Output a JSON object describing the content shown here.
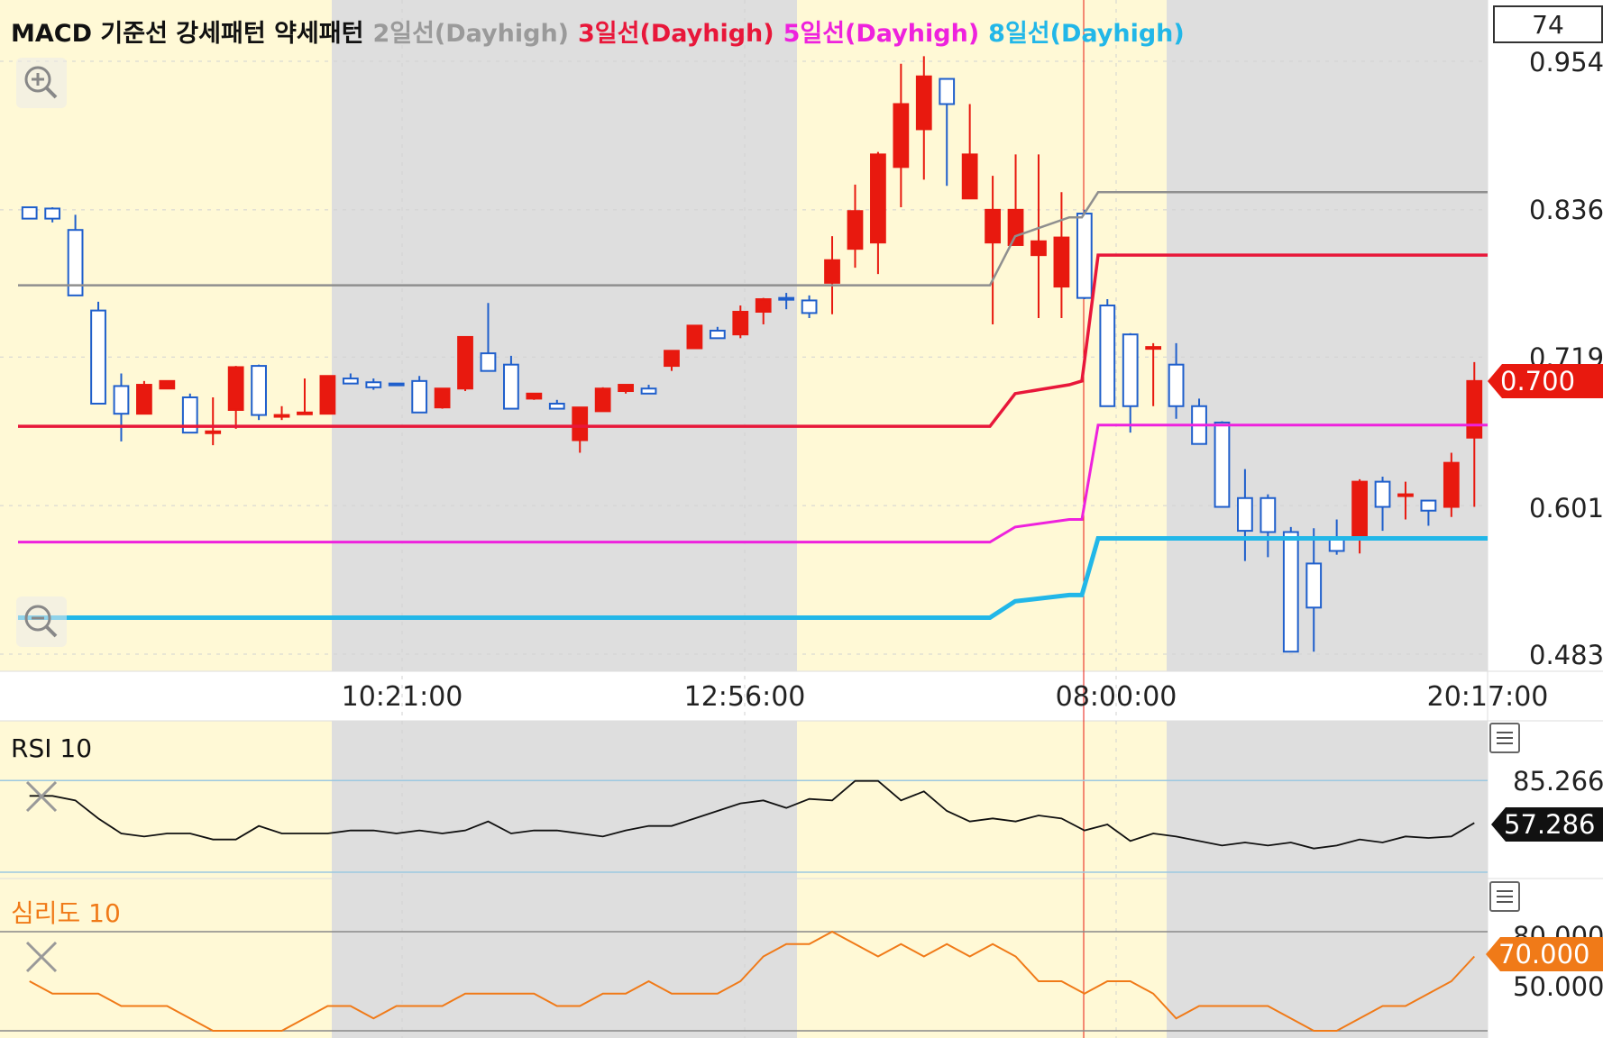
{
  "legend": [
    {
      "text": "MACD 기준선 강세패턴 약세패턴",
      "color": "#111111"
    },
    {
      "text": "2일선(Dayhigh)",
      "color": "#9a9a9a"
    },
    {
      "text": "3일선(Dayhigh)",
      "color": "#e8173a"
    },
    {
      "text": "5일선(Dayhigh)",
      "color": "#ee22dd"
    },
    {
      "text": "8일선(Dayhigh)",
      "color": "#22b7e8"
    }
  ],
  "top_box_value": "74",
  "price_axis": [
    "0.954",
    "0.836",
    "0.719",
    "0.601",
    "0.483"
  ],
  "current_price": "0.700",
  "time_axis": [
    "10:21:00",
    "12:56:00",
    "08:00:00",
    "20:17:00"
  ],
  "rsi": {
    "title": "RSI 10",
    "levels": [
      "85.266",
      "57.286"
    ],
    "current": "57.286"
  },
  "psych": {
    "title": "심리도 10",
    "levels": [
      "80.000",
      "50.000"
    ],
    "current": "70.000"
  },
  "colors": {
    "up": "#e8190f",
    "down": "#1f5fcc",
    "bg_yellow": "#fff9d6",
    "bg_gray": "#dedede",
    "ma2": "#8f8f8f",
    "ma3": "#e8173a",
    "ma5": "#ee22dd",
    "ma8": "#22b7e8",
    "rsi_line": "#111111",
    "psych_line": "#f07a18"
  },
  "chart_data": {
    "type": "candlestick",
    "x": [
      "10:21:00",
      "12:56:00",
      "08:00:00",
      "20:17:00"
    ],
    "ylim": [
      0.483,
      0.954
    ],
    "series": [
      {
        "name": "2일선(Dayhigh)",
        "values": [
          0.776,
          0.776,
          0.776,
          0.776,
          0.815,
          0.83,
          0.83,
          0.85,
          0.85,
          0.85
        ]
      },
      {
        "name": "3일선(Dayhigh)",
        "values": [
          0.664,
          0.664,
          0.664,
          0.664,
          0.69,
          0.697,
          0.7,
          0.8,
          0.8,
          0.8
        ]
      },
      {
        "name": "5일선(Dayhigh)",
        "values": [
          0.572,
          0.572,
          0.572,
          0.572,
          0.584,
          0.59,
          0.59,
          0.665,
          0.665,
          0.665
        ]
      },
      {
        "name": "8일선(Dayhigh)",
        "values": [
          0.512,
          0.512,
          0.512,
          0.512,
          0.525,
          0.53,
          0.53,
          0.575,
          0.575,
          0.575
        ]
      }
    ],
    "candles": [
      [
        0.838,
        0.838,
        0.829,
        0.829
      ],
      [
        0.837,
        0.838,
        0.826,
        0.829
      ],
      [
        0.82,
        0.832,
        0.768,
        0.768
      ],
      [
        0.756,
        0.763,
        0.682,
        0.682
      ],
      [
        0.696,
        0.706,
        0.652,
        0.674
      ],
      [
        0.674,
        0.7,
        0.674,
        0.697
      ],
      [
        0.694,
        0.7,
        0.694,
        0.7
      ],
      [
        0.687,
        0.69,
        0.662,
        0.659
      ],
      [
        0.66,
        0.687,
        0.649,
        0.66
      ],
      [
        0.677,
        0.712,
        0.662,
        0.711
      ],
      [
        0.712,
        0.713,
        0.669,
        0.673
      ],
      [
        0.672,
        0.68,
        0.669,
        0.673
      ],
      [
        0.675,
        0.702,
        0.675,
        0.675
      ],
      [
        0.674,
        0.704,
        0.674,
        0.704
      ],
      [
        0.702,
        0.706,
        0.7,
        0.698
      ],
      [
        0.699,
        0.702,
        0.693,
        0.695
      ],
      [
        0.698,
        0.698,
        0.696,
        0.697
      ],
      [
        0.7,
        0.704,
        0.676,
        0.675
      ],
      [
        0.679,
        0.694,
        0.678,
        0.694
      ],
      [
        0.694,
        0.735,
        0.692,
        0.735
      ],
      [
        0.722,
        0.762,
        0.709,
        0.708
      ],
      [
        0.713,
        0.72,
        0.678,
        0.678
      ],
      [
        0.686,
        0.689,
        0.685,
        0.69
      ],
      [
        0.682,
        0.685,
        0.678,
        0.678
      ],
      [
        0.653,
        0.679,
        0.643,
        0.679
      ],
      [
        0.676,
        0.695,
        0.677,
        0.694
      ],
      [
        0.692,
        0.697,
        0.69,
        0.697
      ],
      [
        0.694,
        0.697,
        0.69,
        0.69
      ],
      [
        0.712,
        0.724,
        0.708,
        0.724
      ],
      [
        0.726,
        0.744,
        0.726,
        0.744
      ],
      [
        0.74,
        0.743,
        0.735,
        0.734
      ],
      [
        0.737,
        0.76,
        0.734,
        0.755
      ],
      [
        0.755,
        0.766,
        0.745,
        0.765
      ],
      [
        0.766,
        0.77,
        0.757,
        0.765
      ],
      [
        0.764,
        0.768,
        0.75,
        0.754
      ],
      [
        0.778,
        0.815,
        0.753,
        0.796
      ],
      [
        0.805,
        0.856,
        0.79,
        0.835
      ],
      [
        0.81,
        0.882,
        0.785,
        0.88
      ],
      [
        0.87,
        0.952,
        0.838,
        0.92
      ],
      [
        0.9,
        0.958,
        0.86,
        0.942
      ],
      [
        0.94,
        0.937,
        0.855,
        0.92
      ],
      [
        0.845,
        0.92,
        0.88,
        0.88
      ],
      [
        0.81,
        0.863,
        0.745,
        0.836
      ],
      [
        0.808,
        0.88,
        0.81,
        0.836
      ],
      [
        0.8,
        0.88,
        0.75,
        0.811
      ],
      [
        0.775,
        0.85,
        0.75,
        0.814
      ],
      [
        0.833,
        0.836,
        0.765,
        0.766
      ],
      [
        0.76,
        0.765,
        0.68,
        0.68
      ],
      [
        0.737,
        0.738,
        0.659,
        0.68
      ],
      [
        0.727,
        0.73,
        0.68,
        0.727
      ],
      [
        0.713,
        0.73,
        0.67,
        0.68
      ],
      [
        0.68,
        0.686,
        0.66,
        0.65
      ],
      [
        0.667,
        0.668,
        0.601,
        0.6
      ],
      [
        0.607,
        0.63,
        0.557,
        0.581
      ],
      [
        0.607,
        0.61,
        0.56,
        0.58
      ],
      [
        0.58,
        0.584,
        0.485,
        0.485
      ],
      [
        0.555,
        0.583,
        0.485,
        0.52
      ],
      [
        0.574,
        0.59,
        0.562,
        0.565
      ],
      [
        0.575,
        0.622,
        0.563,
        0.62
      ],
      [
        0.62,
        0.624,
        0.581,
        0.6
      ],
      [
        0.61,
        0.62,
        0.59,
        0.61
      ],
      [
        0.605,
        0.6,
        0.585,
        0.597
      ],
      [
        0.6,
        0.643,
        0.592,
        0.635
      ],
      [
        0.655,
        0.715,
        0.6,
        0.7
      ]
    ]
  },
  "rsi_data": {
    "type": "line",
    "upper": 85.266,
    "lower": 30,
    "values": [
      75,
      75,
      72,
      60,
      50,
      48,
      50,
      50,
      46,
      46,
      55,
      50,
      50,
      50,
      52,
      52,
      50,
      52,
      50,
      52,
      58,
      50,
      52,
      52,
      50,
      48,
      52,
      55,
      55,
      60,
      65,
      70,
      72,
      67,
      73,
      72,
      85,
      85,
      72,
      78,
      65,
      58,
      60,
      58,
      62,
      60,
      52,
      56,
      45,
      50,
      48,
      45,
      42,
      44,
      42,
      44,
      40,
      42,
      46,
      44,
      48,
      47,
      48,
      57
    ],
    "ylim": [
      20,
      95
    ]
  },
  "psych_data": {
    "type": "line",
    "upper": 80,
    "lower": 40,
    "values": [
      60,
      55,
      55,
      55,
      50,
      50,
      50,
      45,
      40,
      40,
      40,
      40,
      45,
      50,
      50,
      45,
      50,
      50,
      50,
      55,
      55,
      55,
      55,
      50,
      50,
      55,
      55,
      60,
      55,
      55,
      55,
      60,
      70,
      75,
      75,
      80,
      75,
      70,
      75,
      70,
      75,
      70,
      75,
      70,
      60,
      60,
      55,
      60,
      60,
      55,
      45,
      50,
      50,
      50,
      50,
      45,
      40,
      40,
      45,
      50,
      50,
      55,
      60,
      70
    ]
  }
}
